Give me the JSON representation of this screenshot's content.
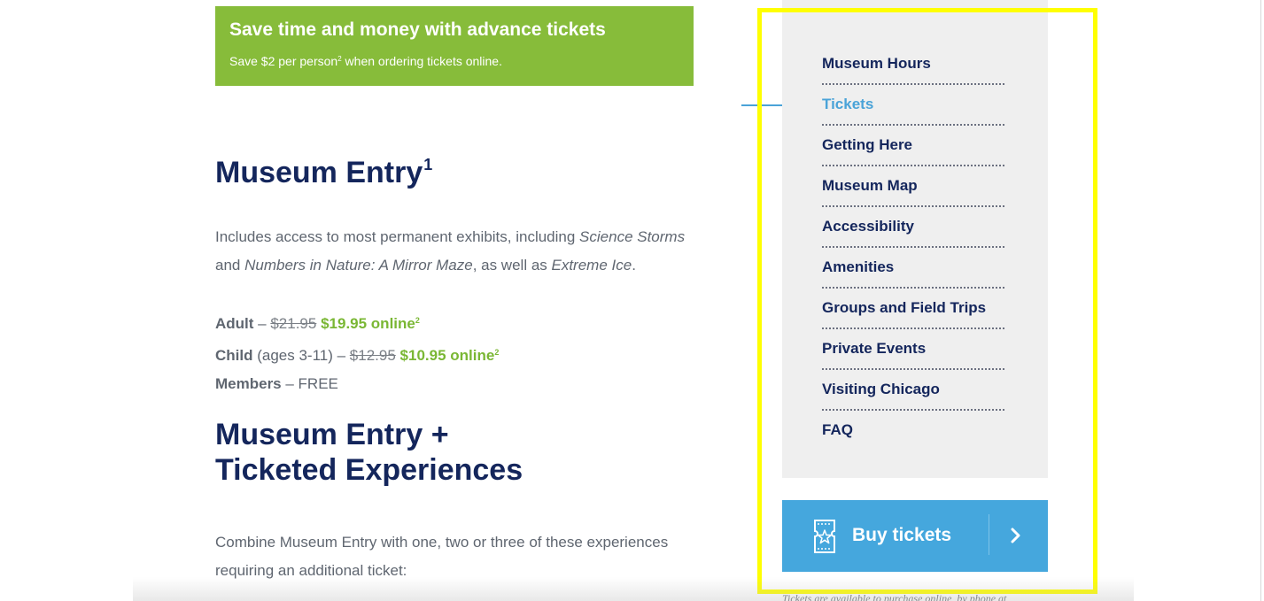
{
  "promo": {
    "title": "Save time and money with advance tickets",
    "subtitle_text": "Save $2 per person",
    "subtitle_sup": "2",
    "subtitle_tail": " when ordering tickets online."
  },
  "entry": {
    "heading": "Museum Entry",
    "heading_sup": "1",
    "desc": {
      "part1": "Includes access to most permanent exhibits, including ",
      "exhibit1": "Science Storms",
      "part2": " and ",
      "exhibit2": "Numbers in Nature: A Mirror Maze",
      "part3": ", as well as ",
      "exhibit3": "Extreme Ice",
      "part4": "."
    },
    "prices": {
      "adult_label": "Adult",
      "adult_sep": " – ",
      "adult_old": "$21.95",
      "adult_new": "$19.95 online",
      "adult_sup": "2",
      "child_label": "Child",
      "child_ages": " (ages 3-11) – ",
      "child_old": "$12.95",
      "child_new": "$10.95 online",
      "child_sup": "2",
      "members_label": "Members",
      "members_value": " – FREE"
    }
  },
  "ticketed": {
    "heading_line1": "Museum Entry +",
    "heading_line2": "Ticketed Experiences",
    "desc": "Combine Museum Entry with one, two or three of these experiences requiring an additional ticket:"
  },
  "sidebar": {
    "items": [
      {
        "label": "Museum Hours"
      },
      {
        "label": "Tickets"
      },
      {
        "label": "Getting Here"
      },
      {
        "label": "Museum Map"
      },
      {
        "label": "Accessibility"
      },
      {
        "label": "Amenities"
      },
      {
        "label": "Groups and Field Trips"
      },
      {
        "label": "Private Events"
      },
      {
        "label": "Visiting Chicago"
      },
      {
        "label": "FAQ"
      }
    ],
    "active_item": "Tickets",
    "buy_button": {
      "label": "Buy tickets",
      "icon": "ticket-star-icon",
      "chevron": "chevron-right-icon"
    },
    "note": "Tickets are available to purchase online, by phone at"
  },
  "colors": {
    "navy": "#14265c",
    "green": "#87bc3a",
    "blue": "#45a7dd",
    "panel": "#efefef",
    "highlight": "#ffff00"
  }
}
